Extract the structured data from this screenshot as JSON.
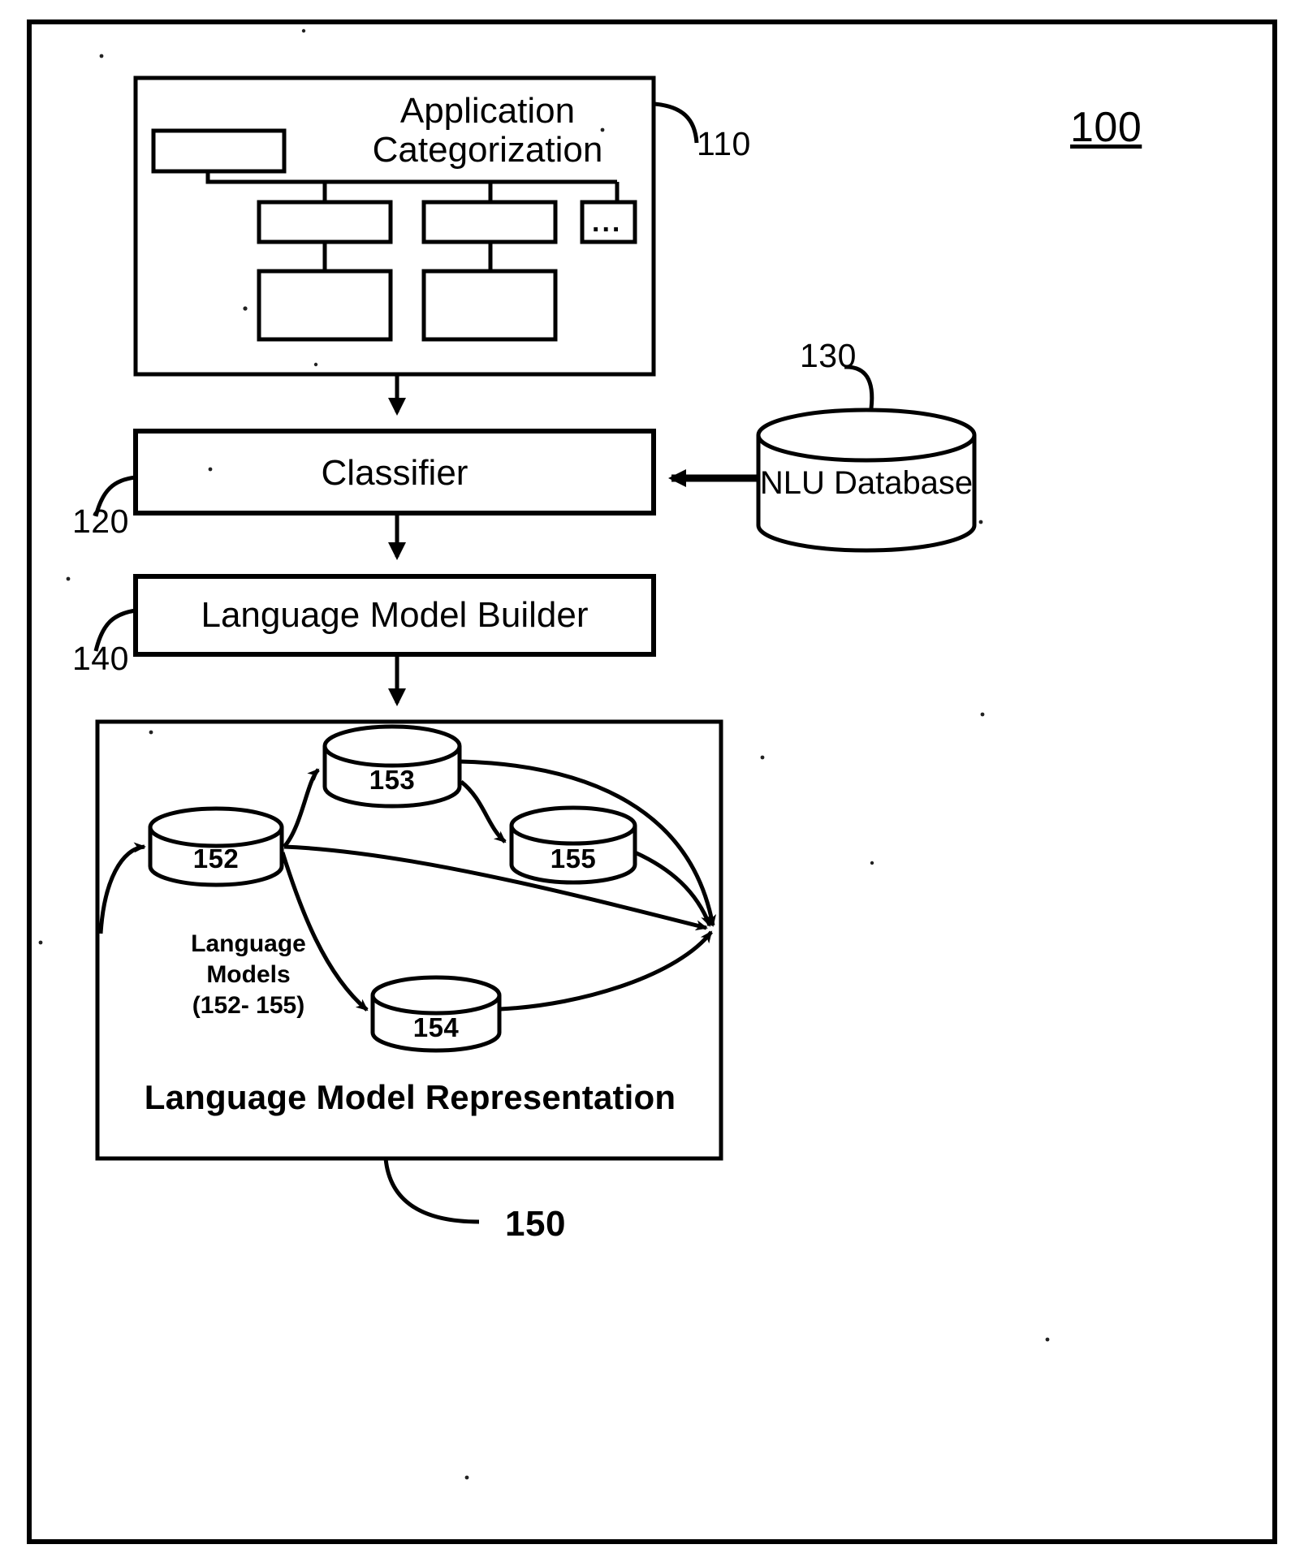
{
  "figure": {
    "number": "100",
    "outer_border": true
  },
  "blocks": {
    "application_categorization": {
      "label_line1": "Application",
      "label_line2": "Categorization",
      "ref": "110",
      "tree_ellipsis": "...",
      "tree_nodes": 6
    },
    "classifier": {
      "label": "Classifier",
      "ref": "120"
    },
    "nlu_database": {
      "label": "NLU Database",
      "ref": "130"
    },
    "language_model_builder": {
      "label": "Language Model Builder",
      "ref": "140"
    },
    "language_model_representation": {
      "label": "Language Model Representation",
      "ref": "150",
      "caption_line1": "Language",
      "caption_line2": "Models",
      "caption_line3": "(152- 155)",
      "cylinders": [
        {
          "id": "cyl-152",
          "label": "152"
        },
        {
          "id": "cyl-153",
          "label": "153"
        },
        {
          "id": "cyl-154",
          "label": "154"
        },
        {
          "id": "cyl-155",
          "label": "155"
        }
      ]
    }
  },
  "colors": {
    "ink": "#000000",
    "paper": "#ffffff"
  }
}
